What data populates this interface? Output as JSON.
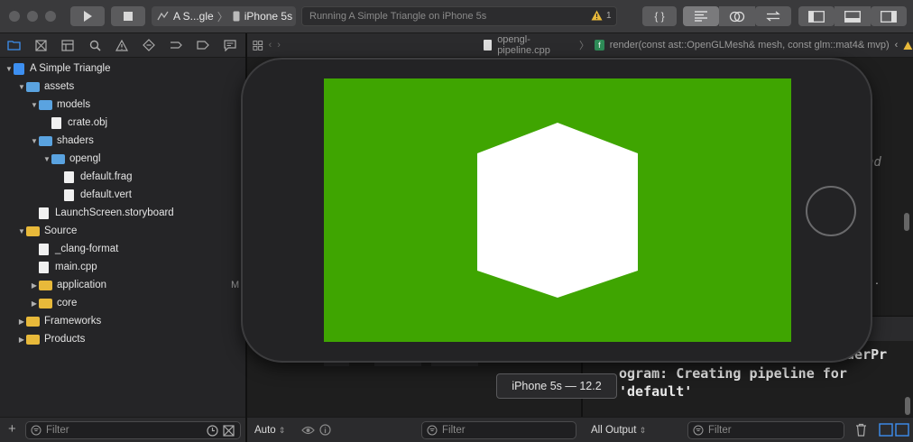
{
  "toolbar": {
    "scheme_name": "A S...gle",
    "scheme_separator": "〉",
    "device_name": "iPhone 5s",
    "activity_text": "Running A Simple Triangle on iPhone 5s",
    "warning_count": "1",
    "code_review_label": "{ }"
  },
  "jumpbar": {
    "file_name": "opengl-pipeline.cpp",
    "function_name": "render(const ast::OpenGLMesh& mesh, const glm::mat4& mvp)"
  },
  "navigator": {
    "items": [
      {
        "label": "A Simple Triangle",
        "kind": "project",
        "indent": 0,
        "disclosure": "open"
      },
      {
        "label": "assets",
        "kind": "folder-blue",
        "indent": 1,
        "disclosure": "open"
      },
      {
        "label": "models",
        "kind": "folder-blue",
        "indent": 2,
        "disclosure": "open"
      },
      {
        "label": "crate.obj",
        "kind": "file",
        "indent": 3,
        "disclosure": "none"
      },
      {
        "label": "shaders",
        "kind": "folder-blue",
        "indent": 2,
        "disclosure": "open"
      },
      {
        "label": "opengl",
        "kind": "folder-blue",
        "indent": 3,
        "disclosure": "open"
      },
      {
        "label": "default.frag",
        "kind": "file",
        "indent": 4,
        "disclosure": "none"
      },
      {
        "label": "default.vert",
        "kind": "file",
        "indent": 4,
        "disclosure": "none"
      },
      {
        "label": "LaunchScreen.storyboard",
        "kind": "file",
        "indent": 2,
        "disclosure": "none"
      },
      {
        "label": "Source",
        "kind": "folder-yellow",
        "indent": 1,
        "disclosure": "open"
      },
      {
        "label": "_clang-format",
        "kind": "file",
        "indent": 2,
        "disclosure": "none"
      },
      {
        "label": "main.cpp",
        "kind": "file",
        "indent": 2,
        "disclosure": "none"
      },
      {
        "label": "application",
        "kind": "folder-yellow",
        "indent": 2,
        "disclosure": "closed",
        "badge": "M"
      },
      {
        "label": "core",
        "kind": "folder-yellow",
        "indent": 2,
        "disclosure": "closed"
      },
      {
        "label": "Frameworks",
        "kind": "folder-yellow",
        "indent": 1,
        "disclosure": "closed"
      },
      {
        "label": "Products",
        "kind": "folder-yellow",
        "indent": 1,
        "disclosure": "closed"
      }
    ],
    "filter_placeholder": "Filter"
  },
  "editor": {
    "fragment_text": "nd",
    "fragment_dot": "."
  },
  "console": {
    "lines": [
      "aderPr",
      "ogram: Creating pipeline for",
      "'default'"
    ],
    "output_selector": "All Output",
    "filter_placeholder": "Filter"
  },
  "variables": {
    "auto_selector": "Auto",
    "filter_placeholder": "Filter"
  },
  "simulator": {
    "tooltip": "iPhone 5s — 12.2",
    "screen_color": "#3fa501"
  },
  "colors": {
    "accent": "#3d8ff0",
    "warning": "#e8b93a"
  }
}
